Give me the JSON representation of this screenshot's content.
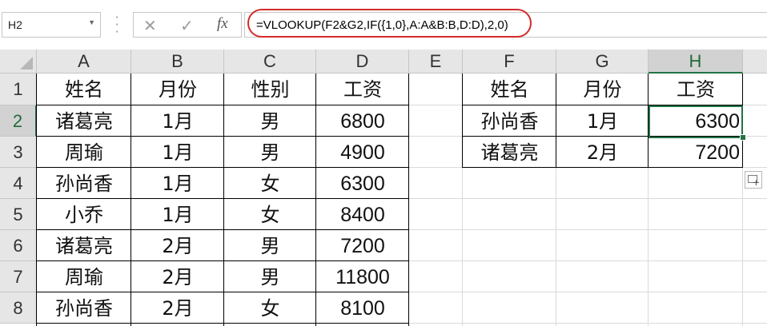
{
  "formula_bar": {
    "name_box": "H2",
    "formula": "=VLOOKUP(F2&G2,IF({1,0},A:A&B:B,D:D),2,0)",
    "fx_label": "fx"
  },
  "columns": [
    "A",
    "B",
    "C",
    "D",
    "E",
    "F",
    "G",
    "H"
  ],
  "rows": [
    "1",
    "2",
    "3",
    "4",
    "5",
    "6",
    "7",
    "8"
  ],
  "table_main": {
    "headers": [
      "姓名",
      "月份",
      "性别",
      "工资"
    ],
    "rows": [
      [
        "诸葛亮",
        "1月",
        "男",
        "6800"
      ],
      [
        "周瑜",
        "1月",
        "男",
        "4900"
      ],
      [
        "孙尚香",
        "1月",
        "女",
        "6300"
      ],
      [
        "小乔",
        "1月",
        "女",
        "8400"
      ],
      [
        "诸葛亮",
        "2月",
        "男",
        "7200"
      ],
      [
        "周瑜",
        "2月",
        "男",
        "11800"
      ],
      [
        "孙尚香",
        "2月",
        "女",
        "8100"
      ]
    ]
  },
  "table_lookup": {
    "headers": [
      "姓名",
      "月份",
      "工资"
    ],
    "rows": [
      [
        "孙尚香",
        "1月",
        "6300"
      ],
      [
        "诸葛亮",
        "2月",
        "7200"
      ]
    ]
  },
  "selection": {
    "active_cell": "H2",
    "active_column": "H",
    "active_row": "2"
  },
  "colors": {
    "accent": "#217346",
    "highlight_ring": "#d42a2a",
    "header_bg": "#e6e6e6"
  },
  "icons": [
    "cancel-icon",
    "enter-check-icon",
    "fx-icon",
    "quick-analysis-icon"
  ]
}
